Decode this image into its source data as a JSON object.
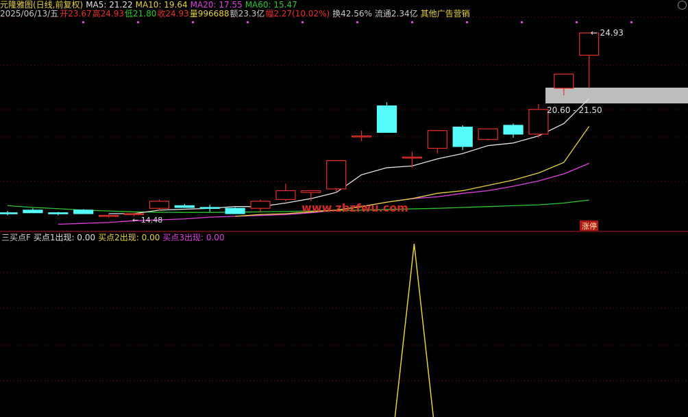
{
  "header": {
    "title": "元隆雅图(日线,前复权)",
    "ma5": "MA5: 21.22",
    "ma10": "MA10: 19.64",
    "ma20": "MA20: 17.55",
    "ma60": "MA60: 15.47",
    "date": "2025/06/13/五",
    "open_label": "开",
    "open_value": "23.67",
    "high_label": "高",
    "high_value": "24.93",
    "low_label": "低",
    "low_value": "21.80",
    "close_label": "收",
    "close_value": "24.93",
    "vol_label": "量",
    "vol_value": "996688",
    "amt_label": "额",
    "amt_value": "23.3亿",
    "chg_label": "幅",
    "chg_value": "2.27(10.02%)",
    "turnover": "换42.56%",
    "float": "流通2.34亿",
    "extra": "其他广告营销"
  },
  "indicator": {
    "name": "三买点F",
    "b1": "买点1出现: 0.00",
    "b2": "买点2出现: 0.00",
    "b3": "买点3出现: 0.00"
  },
  "colors": {
    "up": "#e8302a",
    "down": "#54fcfc",
    "ma5": "#e0e0e0",
    "ma10": "#e6d23c",
    "ma20": "#e040e0",
    "ma60": "#2ec82e",
    "b2": "#e6d23c",
    "b3": "#e040e0",
    "grid": "#7a1010",
    "highlight": "#bdbdbd"
  },
  "chart_data": {
    "type": "candlestick",
    "candles": [
      {
        "o": 14.75,
        "h": 14.85,
        "l": 14.6,
        "c": 14.7
      },
      {
        "o": 14.9,
        "h": 15.0,
        "l": 14.75,
        "c": 14.75
      },
      {
        "o": 14.75,
        "h": 14.8,
        "l": 14.6,
        "c": 14.7
      },
      {
        "o": 14.9,
        "h": 14.95,
        "l": 14.7,
        "c": 14.7
      },
      {
        "o": 14.55,
        "h": 14.65,
        "l": 14.48,
        "c": 14.6
      },
      {
        "o": 14.65,
        "h": 14.75,
        "l": 14.55,
        "c": 14.7
      },
      {
        "o": 15.0,
        "h": 15.5,
        "l": 14.85,
        "c": 15.4
      },
      {
        "o": 15.15,
        "h": 15.25,
        "l": 15.05,
        "c": 15.05
      },
      {
        "o": 15.05,
        "h": 15.2,
        "l": 14.8,
        "c": 15.0
      },
      {
        "o": 15.0,
        "h": 15.05,
        "l": 14.7,
        "c": 14.7
      },
      {
        "o": 15.0,
        "h": 15.5,
        "l": 14.8,
        "c": 15.4
      },
      {
        "o": 15.5,
        "h": 16.4,
        "l": 15.4,
        "c": 16.0
      },
      {
        "o": 15.9,
        "h": 16.0,
        "l": 15.4,
        "c": 16.0
      },
      {
        "o": 16.1,
        "h": 17.7,
        "l": 15.9,
        "c": 17.7
      },
      {
        "o": 19.1,
        "h": 19.4,
        "l": 18.8,
        "c": 19.1
      },
      {
        "o": 20.8,
        "h": 21.0,
        "l": 19.3,
        "c": 19.3
      },
      {
        "o": 17.9,
        "h": 18.2,
        "l": 17.3,
        "c": 17.9
      },
      {
        "o": 18.4,
        "h": 19.4,
        "l": 18.1,
        "c": 19.4
      },
      {
        "o": 19.6,
        "h": 19.7,
        "l": 18.3,
        "c": 18.5
      },
      {
        "o": 18.9,
        "h": 19.5,
        "l": 18.85,
        "c": 19.5
      },
      {
        "o": 19.7,
        "h": 19.8,
        "l": 19.0,
        "c": 19.2
      },
      {
        "o": 19.2,
        "h": 20.9,
        "l": 19.0,
        "c": 20.6
      },
      {
        "o": 21.8,
        "h": 22.6,
        "l": 21.4,
        "c": 22.6
      },
      {
        "o": 23.67,
        "h": 24.93,
        "l": 21.8,
        "c": 24.93
      }
    ],
    "ma5": [
      null,
      null,
      null,
      null,
      14.7,
      14.7,
      14.9,
      14.95,
      15.0,
      15.1,
      15.1,
      15.3,
      15.55,
      15.9,
      16.9,
      17.3,
      17.4,
      17.8,
      18.1,
      18.55,
      18.7,
      19.1,
      19.8,
      21.22
    ],
    "ma10": [
      null,
      null,
      null,
      null,
      null,
      null,
      null,
      null,
      null,
      14.55,
      14.65,
      14.7,
      14.8,
      14.9,
      15.1,
      15.35,
      15.55,
      15.85,
      16.0,
      16.3,
      16.6,
      17.0,
      17.6,
      19.64
    ],
    "ma20": [
      null,
      null,
      14.1,
      14.15,
      14.2,
      14.3,
      14.35,
      14.4,
      14.5,
      14.55,
      14.6,
      14.65,
      14.75,
      14.9,
      15.1,
      15.35,
      15.55,
      15.65,
      15.85,
      16.0,
      16.25,
      16.55,
      16.95,
      17.55
    ],
    "ma60": [
      15.15,
      15.05,
      14.98,
      14.9,
      14.85,
      14.8,
      14.78,
      14.77,
      14.77,
      14.78,
      14.8,
      14.82,
      14.85,
      14.88,
      14.9,
      14.93,
      14.97,
      15.0,
      15.05,
      15.1,
      15.15,
      15.2,
      15.3,
      15.47
    ],
    "annotations": {
      "high_text": "24.93",
      "low_text": "14.48",
      "range_text": "20.60 - 21.50",
      "watermark": "www.zbzfwu.com",
      "limit_tag": "涨停"
    },
    "b2_signal": [
      0,
      0,
      0,
      0,
      0,
      0,
      0,
      0,
      0,
      0,
      0,
      0,
      0,
      0,
      0,
      0,
      1,
      0,
      0,
      0,
      0,
      0,
      0,
      0
    ]
  }
}
